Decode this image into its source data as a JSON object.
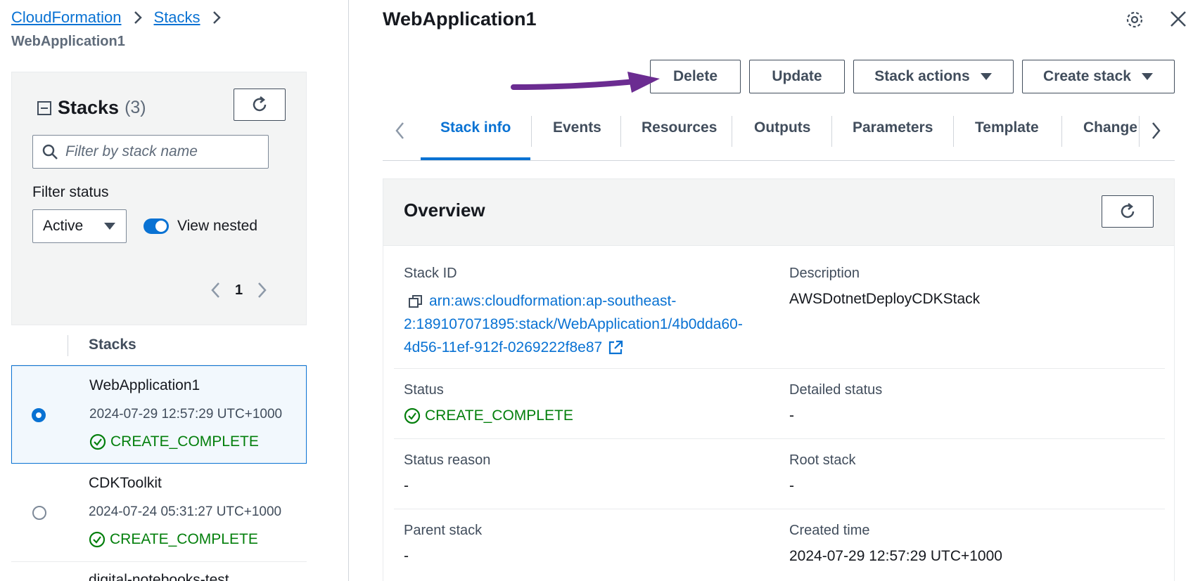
{
  "breadcrumb": {
    "items": [
      "CloudFormation",
      "Stacks"
    ],
    "current": "WebApplication1"
  },
  "sidebar": {
    "title": "Stacks",
    "count": "(3)",
    "search_placeholder": "Filter by stack name",
    "filter_status_label": "Filter status",
    "filter_status_value": "Active",
    "view_nested_label": "View nested",
    "view_nested_on": true,
    "page_number": "1",
    "column_header": "Stacks",
    "stacks": [
      {
        "name": "WebApplication1",
        "time": "2024-07-29 12:57:29 UTC+1000",
        "status": "CREATE_COMPLETE",
        "selected": true
      },
      {
        "name": "CDKToolkit",
        "time": "2024-07-24 05:31:27 UTC+1000",
        "status": "CREATE_COMPLETE",
        "selected": false
      },
      {
        "name": "digital-notebooks-test",
        "time": "",
        "status": "",
        "selected": false
      }
    ]
  },
  "main": {
    "title": "WebApplication1",
    "actions": {
      "delete": "Delete",
      "update": "Update",
      "stack_actions": "Stack actions",
      "create_stack": "Create stack"
    },
    "tabs": [
      "Stack info",
      "Events",
      "Resources",
      "Outputs",
      "Parameters",
      "Template",
      "Change"
    ],
    "active_tab": "Stack info",
    "overview": {
      "title": "Overview",
      "stack_id_label": "Stack ID",
      "stack_id_line1": "arn:aws:cloudformation:ap-southeast-",
      "stack_id_line2": "2:189107071895:stack/WebApplication1/4b0dda60-",
      "stack_id_line3": "4d56-11ef-912f-0269222f8e87",
      "description_label": "Description",
      "description_value": "AWSDotnetDeployCDKStack",
      "status_label": "Status",
      "status_value": "CREATE_COMPLETE",
      "detailed_status_label": "Detailed status",
      "detailed_status_value": "-",
      "status_reason_label": "Status reason",
      "status_reason_value": "-",
      "root_stack_label": "Root stack",
      "root_stack_value": "-",
      "parent_stack_label": "Parent stack",
      "parent_stack_value": "-",
      "created_time_label": "Created time",
      "created_time_value": "2024-07-29 12:57:29 UTC+1000"
    }
  },
  "colors": {
    "link": "#0972d3",
    "success": "#037f0c",
    "arrow": "#6b2c91"
  }
}
